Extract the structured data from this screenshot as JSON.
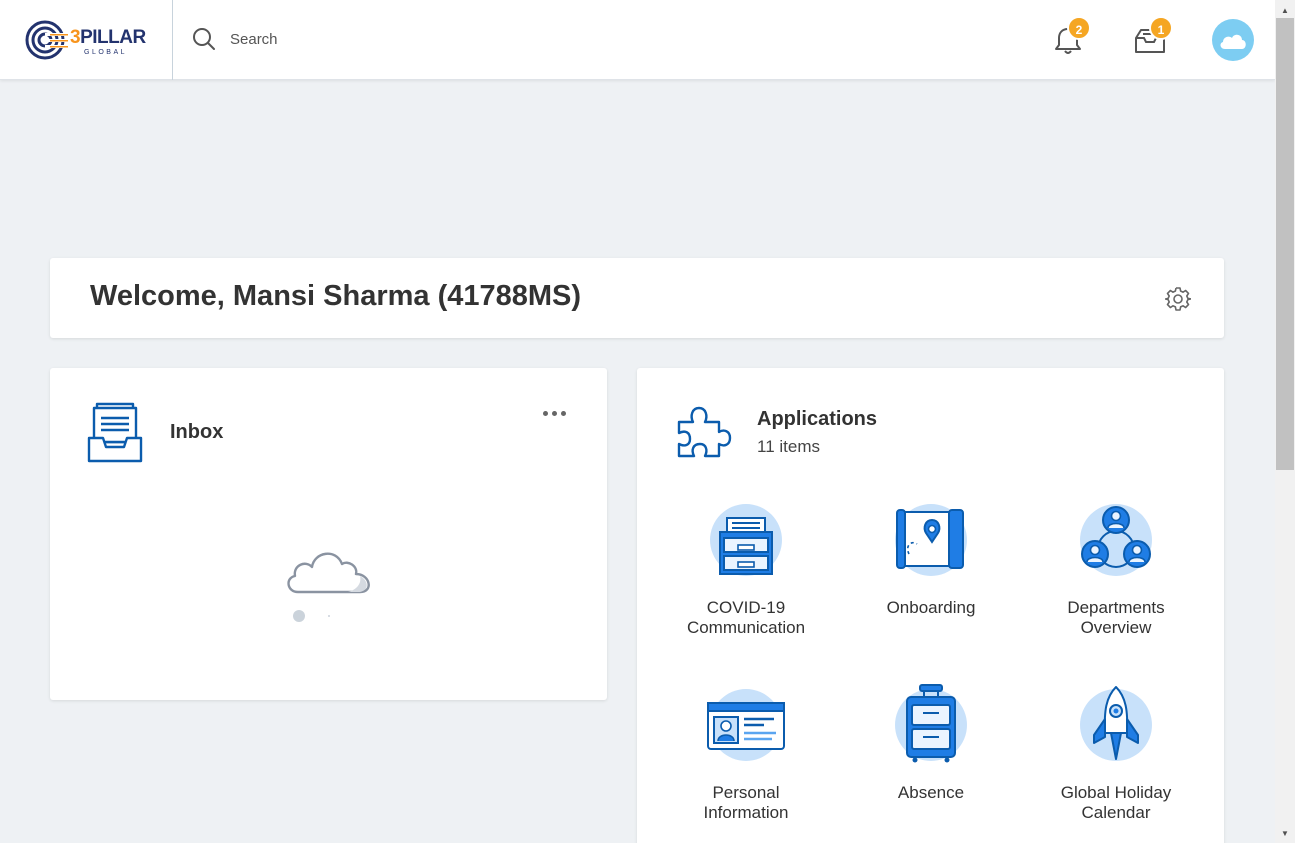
{
  "header": {
    "logo": {
      "main_three": "3",
      "main_rest": "PILLAR",
      "sub": "GLOBAL"
    },
    "search_placeholder": "Search",
    "notifications_count": "2",
    "inbox_count": "1"
  },
  "welcome": {
    "text": "Welcome, Mansi Sharma (41788MS)"
  },
  "inbox": {
    "title": "Inbox"
  },
  "applications": {
    "title": "Applications",
    "count": "11 items",
    "items": [
      {
        "label": "COVID-19\nCommunication",
        "icon": "file-cabinet-icon"
      },
      {
        "label": "Onboarding",
        "icon": "map-pin-icon"
      },
      {
        "label": "Departments\nOverview",
        "icon": "team-icon"
      },
      {
        "label": "Personal\nInformation",
        "icon": "id-card-icon"
      },
      {
        "label": "Absence",
        "icon": "suitcase-icon"
      },
      {
        "label": "Global Holiday\nCalendar",
        "icon": "rocket-icon"
      }
    ]
  },
  "colors": {
    "accent": "#0875e1",
    "badge": "#f5a623",
    "background": "#eef1f4",
    "icon_circle": "#c8e1fa"
  }
}
